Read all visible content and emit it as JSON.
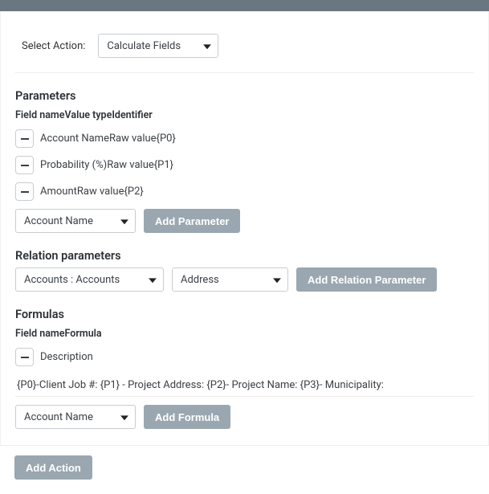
{
  "top": {
    "select_action_label": "Select Action:",
    "action_value": "Calculate Fields"
  },
  "parameters": {
    "title": "Parameters",
    "header": {
      "field": "Field name",
      "type": "Value type",
      "id": "Identifier"
    },
    "rows": [
      {
        "field": "Account Name",
        "type": "Raw value",
        "id": "{P0}"
      },
      {
        "field": "Probability (%)",
        "type": "Raw value",
        "id": "{P1}"
      },
      {
        "field": "Amount",
        "type": "Raw value",
        "id": "{P2}"
      }
    ],
    "select_value": "Account Name",
    "add_label": "Add Parameter"
  },
  "relation": {
    "title": "Relation parameters",
    "source_value": "Accounts : Accounts",
    "field_value": "Address",
    "add_label": "Add Relation Parameter"
  },
  "formulas": {
    "title": "Formulas",
    "header": {
      "field": "Field name",
      "formula": "Formula"
    },
    "rows": [
      {
        "field": "Description",
        "formula": "{P0}-Client Job #: {P1} - Project Address: {P2}- Project Name: {P3}- Municipality:"
      }
    ],
    "select_value": "Account Name",
    "add_label": "Add Formula"
  },
  "footer": {
    "add_action": "Add Action"
  }
}
